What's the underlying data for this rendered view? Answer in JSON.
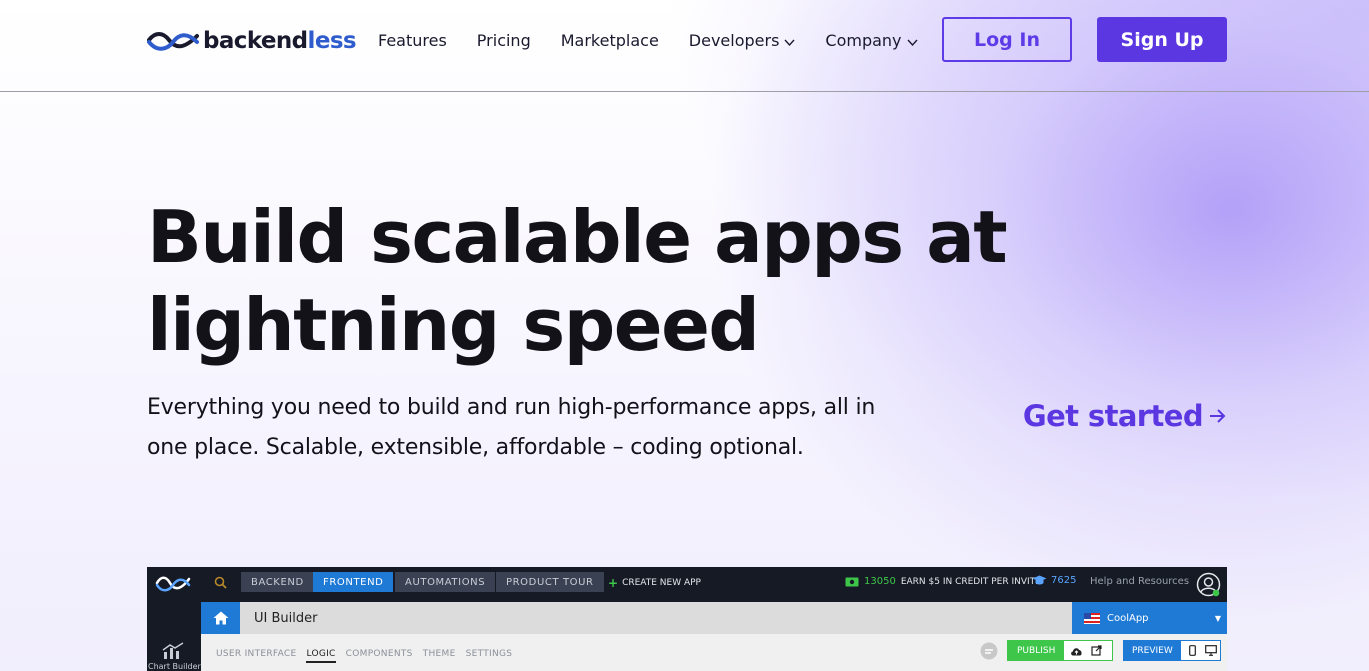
{
  "header": {
    "logo_text_main": "backend",
    "logo_text_accent": "less",
    "nav": [
      {
        "label": "Features"
      },
      {
        "label": "Pricing"
      },
      {
        "label": "Marketplace"
      },
      {
        "label": "Developers"
      },
      {
        "label": "Company"
      }
    ],
    "login_label": "Log In",
    "signup_label": "Sign Up"
  },
  "hero": {
    "title_line1": "Build scalable apps at",
    "title_line2": "lightning speed",
    "subtitle_line1": "Everything you need to build and run high-performance apps, all in",
    "subtitle_line2": "one place. Scalable, extensible, affordable – coding optional.",
    "cta_label": "Get started"
  },
  "app_preview": {
    "tabs": [
      "BACKEND",
      "FRONTEND",
      "AUTOMATIONS",
      "PRODUCT TOUR"
    ],
    "active_tab": "FRONTEND",
    "create_label": "CREATE NEW APP",
    "credits_value": "13050",
    "credits_text": "EARN $5 IN CREDIT PER INVITE",
    "points_value": "7625",
    "help_label": "Help and Resources",
    "side_label": "Chart Builder",
    "page_title": "UI Builder",
    "app_name": "CoolApp",
    "subtabs": [
      "USER INTERFACE",
      "LOGIC",
      "COMPONENTS",
      "THEME",
      "SETTINGS"
    ],
    "active_subtab": "LOGIC",
    "publish_label": "PUBLISH",
    "preview_label": "PREVIEW"
  },
  "colors": {
    "brand_purple": "#5b37e2",
    "app_blue": "#1f7ad6",
    "app_green": "#3ec64b",
    "app_dark": "#151a24"
  }
}
